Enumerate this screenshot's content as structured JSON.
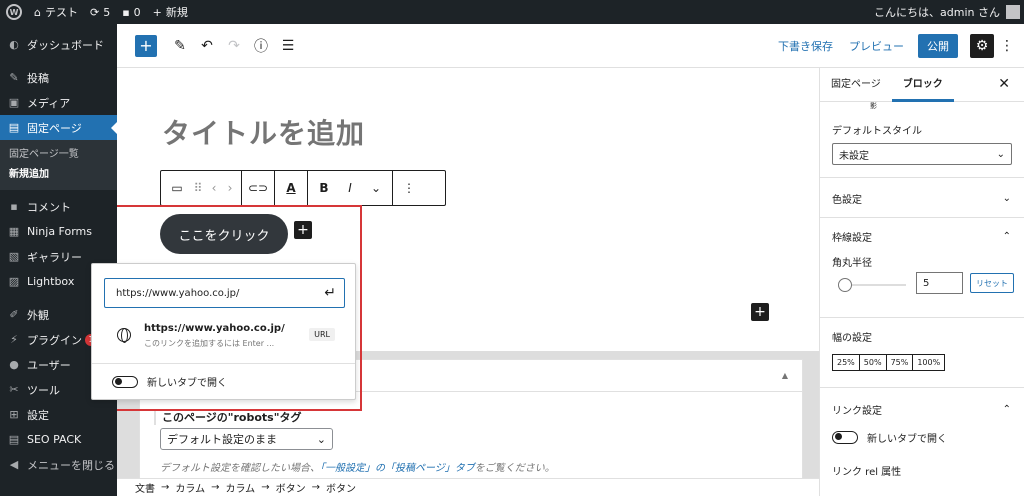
{
  "adminbar": {
    "site_name": "テスト",
    "updates_count": "5",
    "comments_count": "0",
    "new_label": "新規",
    "greeting": "こんにちは、admin さん"
  },
  "sidebar": {
    "items": [
      {
        "label": "ダッシュボード",
        "icon": "dashboard-icon"
      },
      {
        "label": "投稿",
        "icon": "pin-icon"
      },
      {
        "label": "メディア",
        "icon": "media-icon"
      },
      {
        "label": "固定ページ",
        "icon": "page-icon"
      },
      {
        "label": "コメント",
        "icon": "comment-icon"
      },
      {
        "label": "Ninja Forms",
        "icon": "form-icon"
      },
      {
        "label": "ギャラリー",
        "icon": "gallery-icon"
      },
      {
        "label": "Lightbox",
        "icon": "lightbox-icon"
      },
      {
        "label": "外観",
        "icon": "brush-icon"
      },
      {
        "label": "プラグイン",
        "icon": "plugin-icon"
      },
      {
        "label": "ユーザー",
        "icon": "user-icon"
      },
      {
        "label": "ツール",
        "icon": "wrench-icon"
      },
      {
        "label": "設定",
        "icon": "settings-icon"
      },
      {
        "label": "SEO PACK",
        "icon": "seo-icon"
      },
      {
        "label": "メニューを閉じる",
        "icon": "collapse-icon"
      }
    ],
    "submenu": {
      "list": "固定ページ一覧",
      "add_new": "新規追加"
    },
    "plugin_badge": "1"
  },
  "header": {
    "save_draft": "下書き保存",
    "preview": "プレビュー",
    "publish": "公開"
  },
  "content": {
    "title_placeholder": "タイトルを追加",
    "button_text": "ここをクリック"
  },
  "popover": {
    "url_value": "https://www.yahoo.co.jp/",
    "suggestion_url": "https://www.yahoo.co.jp/",
    "suggestion_desc": "このリンクを追加するには Enter ...",
    "suggestion_type": "URL",
    "new_tab_label": "新しいタブで開く"
  },
  "metabox": {
    "robots_label": "このページの\"robots\"タグ",
    "robots_select": "デフォルト設定のまま",
    "note_prefix": "デフォルト設定を確認したい場合、",
    "note_link": "「一般設定」の「投稿ページ」タブ",
    "note_suffix": "をご覧ください。"
  },
  "breadcrumb": [
    "文書",
    "カラム",
    "カラム",
    "ボタン",
    "ボタン"
  ],
  "settings": {
    "tabs": [
      "固定ページ",
      "ブロック"
    ],
    "shadow_label": "影",
    "default_style_label": "デフォルトスタイル",
    "default_style_value": "未設定",
    "color_settings": "色設定",
    "border_settings": "枠線設定",
    "radius_label": "角丸半径",
    "radius_value": "5",
    "reset_label": "リセット",
    "width_settings": "幅の設定",
    "width_options": [
      "25%",
      "50%",
      "75%",
      "100%"
    ],
    "link_settings": "リンク設定",
    "new_tab_label": "新しいタブで開く",
    "link_rel_label": "リンク rel 属性"
  },
  "colors": {
    "accent": "#2271b1",
    "admin_dark": "#1d2327",
    "highlight_red": "#d63638"
  }
}
